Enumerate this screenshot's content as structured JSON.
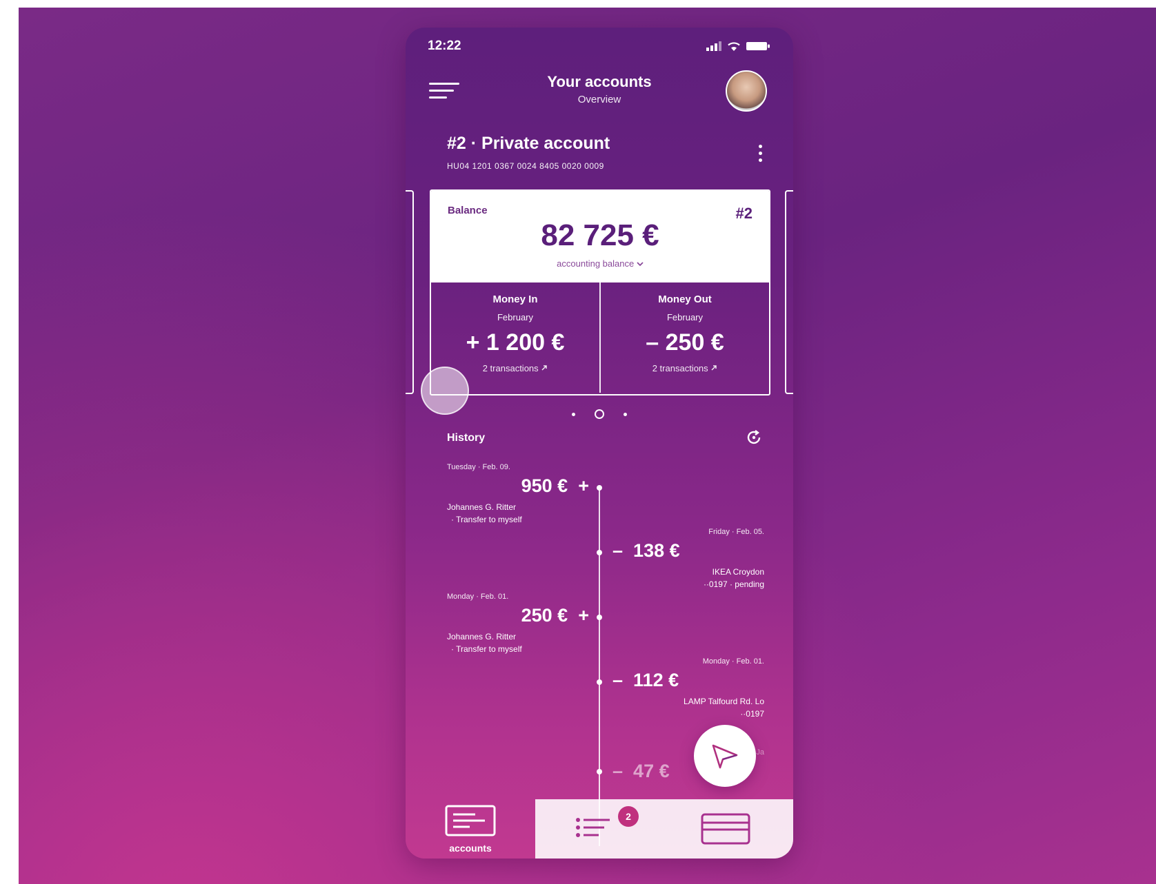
{
  "status": {
    "time": "12:22"
  },
  "header": {
    "title": "Your accounts",
    "subtitle": "Overview"
  },
  "account": {
    "name": "#2 · Private account",
    "iban": "HU04 1201 0367 0024 8405 0020 0009"
  },
  "balance_card": {
    "label": "Balance",
    "number": "#2",
    "amount": "82 725 €",
    "mode": "accounting balance",
    "money_in": {
      "title": "Money In",
      "month": "February",
      "amount": "+ 1 200 €",
      "transactions": "2 transactions"
    },
    "money_out": {
      "title": "Money Out",
      "month": "February",
      "amount": "– 250 €",
      "transactions": "2 transactions"
    }
  },
  "history": {
    "title": "History",
    "transactions": [
      {
        "date": "Tuesday · Feb. 09.",
        "amount": "950 €",
        "sign": "+",
        "name": "Johannes G. Ritter",
        "note": "·  Transfer to myself"
      },
      {
        "date": "Friday · Feb. 05.",
        "amount": "138 €",
        "sign": "–",
        "name": "IKEA Croydon",
        "note": "··0197  ·  pending"
      },
      {
        "date": "Monday · Feb. 01.",
        "amount": "250 €",
        "sign": "+",
        "name": "Johannes G. Ritter",
        "note": "·  Transfer to myself"
      },
      {
        "date": "Monday · Feb. 01.",
        "amount": "112 €",
        "sign": "–",
        "name": "LAMP Talfourd Rd. Lo",
        "note": "··0197"
      },
      {
        "date": "Tuesday · Ja",
        "amount": "47 €",
        "sign": "–",
        "name": "",
        "note": ""
      }
    ]
  },
  "tabs": {
    "accounts": "accounts",
    "notifications_count": "2"
  },
  "colors": {
    "accent": "#5a1f7a",
    "badge": "#c0307e",
    "background": "#6a2380"
  }
}
